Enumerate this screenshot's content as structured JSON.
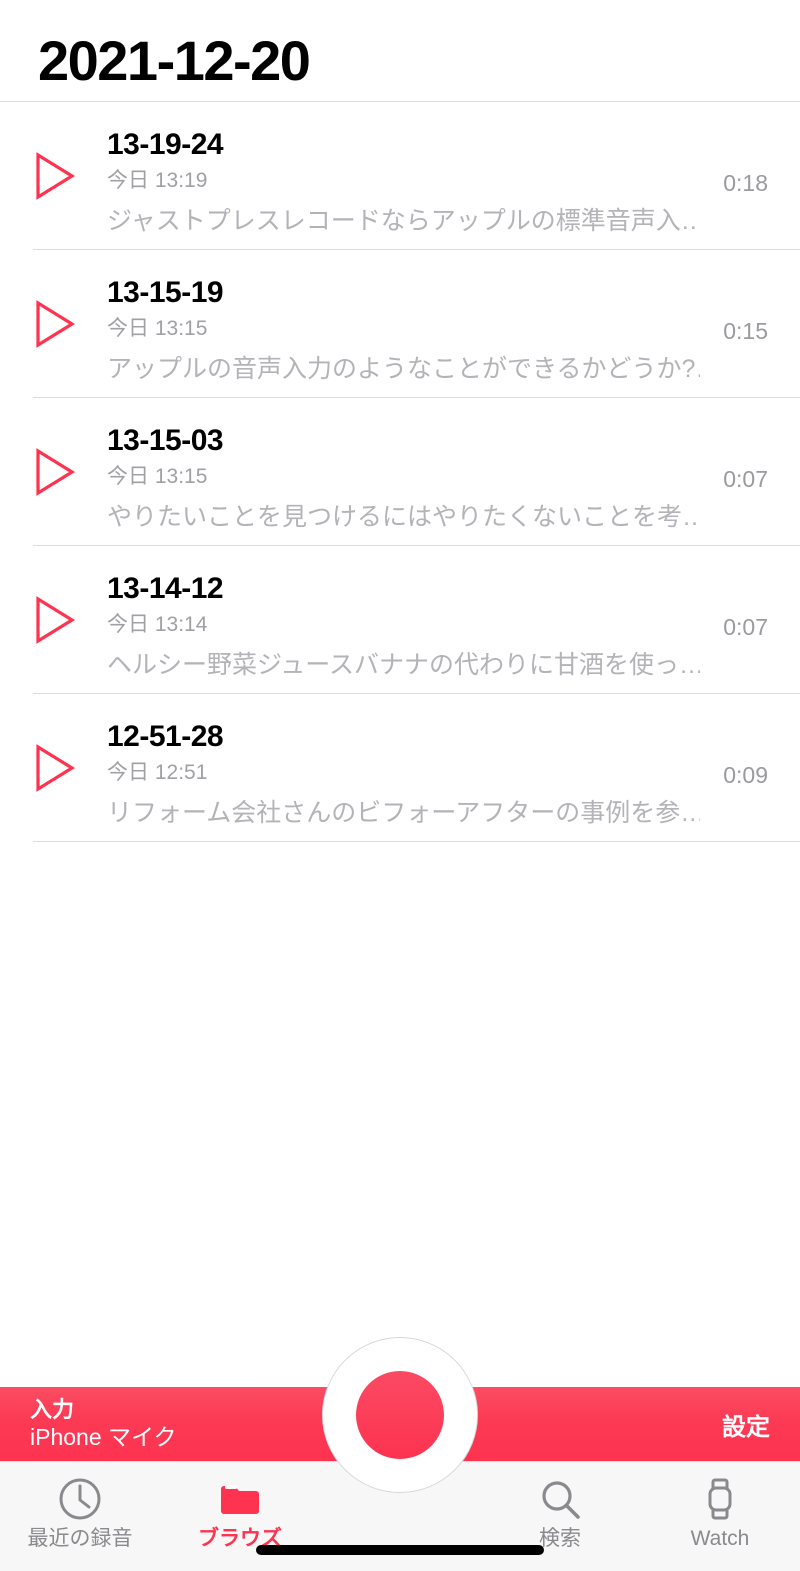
{
  "header": {
    "title": "2021-12-20"
  },
  "memos": [
    {
      "name": "13-19-24",
      "date": "今日 13:19",
      "duration": "0:18",
      "transcript": "ジャストプレスレコードならアップルの標準音声入…",
      "play_icon": "play-triangle-icon"
    },
    {
      "name": "13-15-19",
      "date": "今日 13:15",
      "duration": "0:15",
      "transcript": "アップルの音声入力のようなことができるかどうか?…",
      "play_icon": "play-triangle-icon"
    },
    {
      "name": "13-15-03",
      "date": "今日 13:15",
      "duration": "0:07",
      "transcript": "やりたいことを見つけるにはやりたくないことを考…",
      "play_icon": "play-triangle-icon"
    },
    {
      "name": "13-14-12",
      "date": "今日 13:14",
      "duration": "0:07",
      "transcript": "ヘルシー野菜ジュースバナナの代わりに甘酒を使っ…",
      "play_icon": "play-triangle-icon"
    },
    {
      "name": "12-51-28",
      "date": "今日 12:51",
      "duration": "0:09",
      "transcript": "リフォーム会社さんのビフォーアフターの事例を参…",
      "play_icon": "play-triangle-icon"
    }
  ],
  "record_bar": {
    "input_label": "入力",
    "input_value": "iPhone マイク",
    "settings_label": "設定",
    "record_button_name": "record-button"
  },
  "tabs": [
    {
      "label": "最近の録音",
      "icon": "clock-icon",
      "active": false
    },
    {
      "label": "ブラウズ",
      "icon": "folder-icon",
      "active": true
    },
    {
      "label": "検索",
      "icon": "search-icon",
      "active": false
    },
    {
      "label": "Watch",
      "icon": "watch-icon",
      "active": false
    }
  ],
  "colors": {
    "accent_red": "#fd3350",
    "bar_red_top": "#fb4d63",
    "inactive_gray": "#8a8a8e",
    "separator": "#dcdcdc",
    "transcript_gray": "#b3b3b8",
    "date_gray": "#a0a0a5",
    "tabbar_bg": "#f7f7f7"
  }
}
